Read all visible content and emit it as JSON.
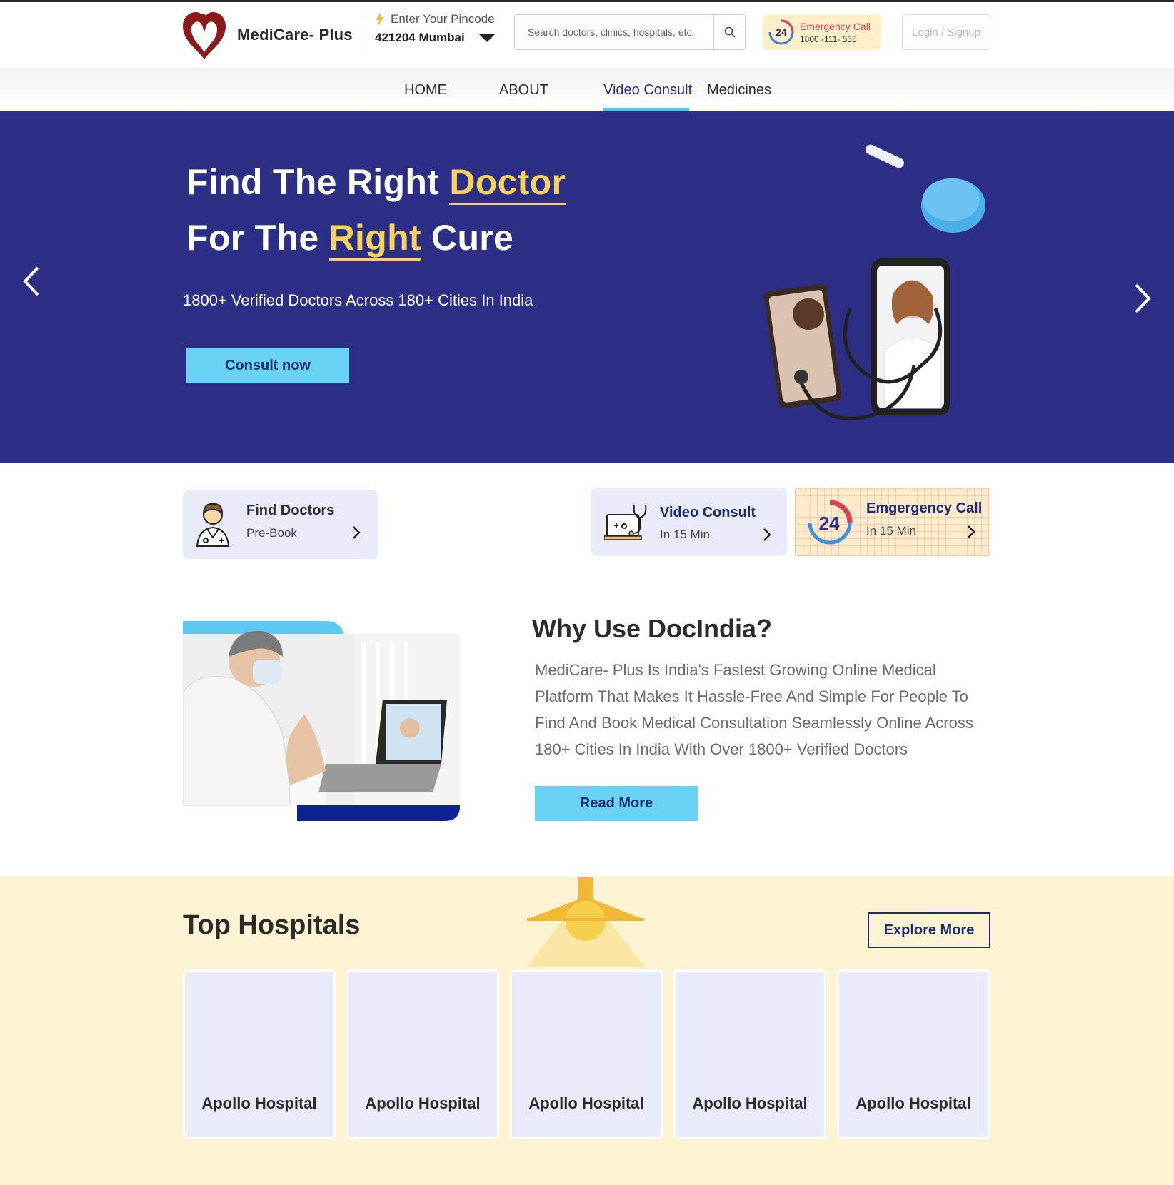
{
  "brand": {
    "name": "MediCare- Plus",
    "logo_color": "#8b1a1a"
  },
  "location": {
    "label": "Enter Your Pincode",
    "value": "421204 Mumbai"
  },
  "search": {
    "placeholder": "Search doctors, clinics, hospitals, etc."
  },
  "emergency": {
    "badge": "24",
    "title": "Emergency Call",
    "phone": "1800 -111- 555"
  },
  "login": {
    "label": "Login / Signup"
  },
  "nav": {
    "items": [
      {
        "label": "HOME"
      },
      {
        "label": "ABOUT"
      },
      {
        "label": "Video Consult",
        "active": true
      },
      {
        "label": "Medicines"
      }
    ]
  },
  "hero": {
    "line1_a": "Find The Right ",
    "line1_b": "Doctor",
    "line2_a": "For The ",
    "line2_b": "Right",
    "line2_c": " Cure",
    "subtitle": "1800+ Verified Doctors Across 180+ Cities In India",
    "cta": "Consult now",
    "bg_color": "#2d2f87",
    "highlight_color": "#f6d25f"
  },
  "services": [
    {
      "title": "Find Doctors",
      "subtitle": "Pre-Book",
      "icon": "doctor-icon"
    },
    {
      "title": "Video Consult",
      "subtitle": "In 15 Min",
      "icon": "video-consult-icon"
    },
    {
      "title": "Emgergency Call",
      "subtitle": "In 15 Min",
      "icon": "24-hours-icon"
    }
  ],
  "why": {
    "title": "Why Use DocIndia?",
    "text": "MediCare- Plus Is India's Fastest Growing Online Medical Platform That Makes It Hassle-Free And Simple For People To Find And Book Medical Consultation Seamlessly Online Across 180+ Cities In India With Over 1800+ Verified Doctors",
    "cta": "Read More"
  },
  "hospitals": {
    "title": "Top Hospitals",
    "cta": "Explore More",
    "items": [
      "Apollo Hospital",
      "Apollo Hospital",
      "Apollo Hospital",
      "Apollo Hospital",
      "Apollo Hospital"
    ]
  }
}
